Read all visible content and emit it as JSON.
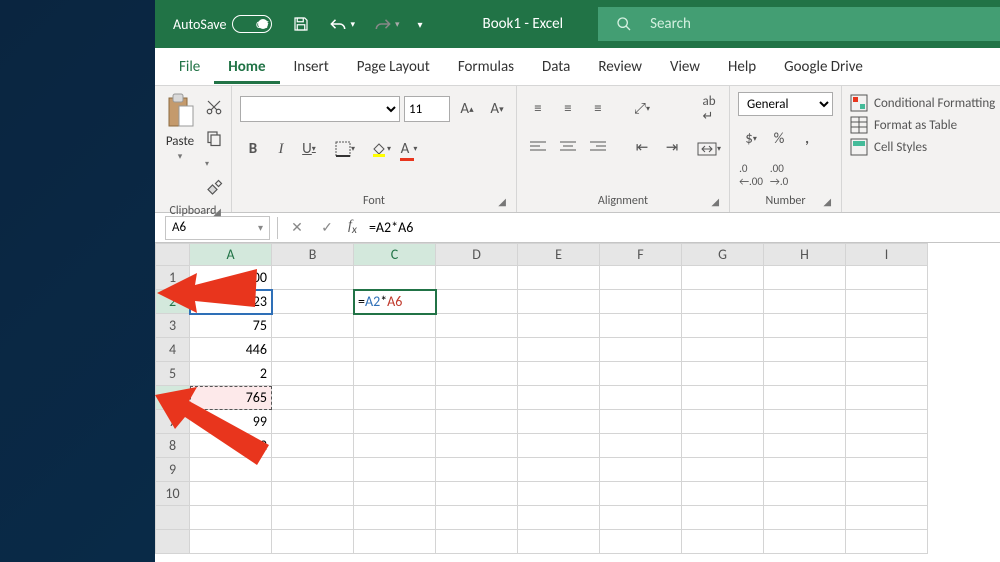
{
  "titlebar": {
    "autosave_label": "AutoSave",
    "autosave_state": "Off",
    "title": "Book1  -  Excel",
    "search_placeholder": "Search"
  },
  "tabs": [
    "File",
    "Home",
    "Insert",
    "Page Layout",
    "Formulas",
    "Data",
    "Review",
    "View",
    "Help",
    "Google Drive"
  ],
  "active_tab": "Home",
  "ribbon": {
    "clipboard": {
      "paste": "Paste",
      "label": "Clipboard"
    },
    "font": {
      "size": "11",
      "label": "Font"
    },
    "alignment": {
      "label": "Alignment"
    },
    "number": {
      "format": "General",
      "label": "Number"
    },
    "styles": {
      "cond": "Conditional Formatting",
      "fmt": "Format as Table",
      "cell": "Cell Styles"
    }
  },
  "namebox": "A6",
  "formula_bar": "=A2*A6",
  "columns": [
    "A",
    "B",
    "C",
    "D",
    "E",
    "F",
    "G",
    "H",
    "I"
  ],
  "rows": [
    "1",
    "2",
    "3",
    "4",
    "5",
    "6",
    "7",
    "8",
    "9",
    "10"
  ],
  "colA": {
    "1": "100",
    "2": "323",
    "3": "75",
    "4": "446",
    "5": "2",
    "6": "765",
    "7": "99",
    "8": "12"
  },
  "editing_cell": {
    "prefix": "=",
    "ref1": "A2",
    "op": "*",
    "ref2": "A6"
  },
  "colors": {
    "ref_blue": "#2e6fb7",
    "ref_red": "#c0392b",
    "accent": "#217346",
    "arrow": "#e8351d"
  }
}
